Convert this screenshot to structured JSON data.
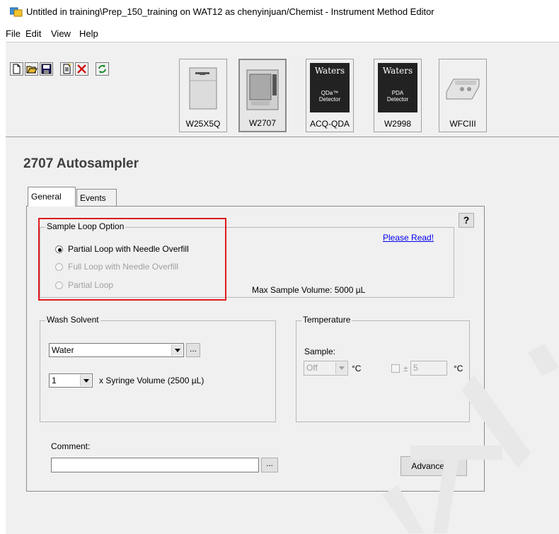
{
  "window": {
    "title": "Untitled in training\\Prep_150_training on WAT12 as chenyinjuan/Chemist - Instrument Method Editor"
  },
  "menu": [
    "File",
    "Edit",
    "View",
    "Help"
  ],
  "toolbar": {
    "buttons": [
      "new-icon",
      "open-icon",
      "save-icon",
      "document-icon",
      "delete-icon",
      "refresh-icon"
    ]
  },
  "instruments": [
    {
      "label": "W25X5Q",
      "selected": false
    },
    {
      "label": "W2707",
      "selected": true
    },
    {
      "label": "ACQ-QDA",
      "selected": false,
      "logo": "Waters",
      "caption_1": "QDa™",
      "caption_2": "Detector"
    },
    {
      "label": "W2998",
      "selected": false,
      "logo": "Waters",
      "caption_1": "PDA",
      "caption_2": "Detector"
    },
    {
      "label": "WFCIII",
      "selected": false
    }
  ],
  "heading": "2707 Autosampler",
  "tabs": [
    {
      "label": "General",
      "active": true
    },
    {
      "label": "Events",
      "active": false
    }
  ],
  "help_button": "?",
  "sample_loop": {
    "legend": "Sample Loop Option",
    "options": [
      {
        "label": "Partial Loop with Needle Overfill",
        "selected": true,
        "enabled": true
      },
      {
        "label": "Full Loop with Needle Overfill",
        "selected": false,
        "enabled": false
      },
      {
        "label": "Partial Loop",
        "selected": false,
        "enabled": false
      }
    ],
    "please_read": "Please Read!",
    "max_volume": "Max Sample Volume: 5000 µL"
  },
  "wash_solvent": {
    "legend": "Wash Solvent",
    "solvent": "Water",
    "browse": "...",
    "multiplier": "1",
    "syringe_label": "x Syringe Volume (2500 µL)"
  },
  "temperature": {
    "legend": "Temperature",
    "sample_label": "Sample:",
    "sample_value": "Off",
    "unit": "°C",
    "tolerance_prefix": "±",
    "tolerance_value": "5",
    "tolerance_unit": "°C"
  },
  "comment": {
    "label": "Comment:",
    "value": "",
    "browse": "..."
  },
  "advanced_button": "Advanced...",
  "colors": {
    "highlight": "#e0191c",
    "link": "#0000ee",
    "panel_bg": "#f0f0f0"
  }
}
